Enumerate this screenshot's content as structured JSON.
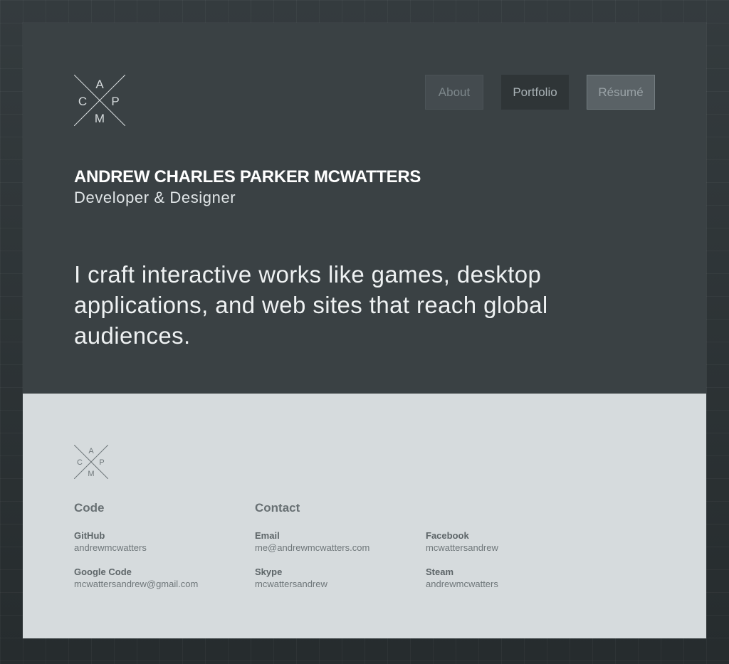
{
  "logo": {
    "letters": {
      "top": "A",
      "left": "C",
      "right": "P",
      "bottom": "M"
    }
  },
  "nav": {
    "about": "About",
    "portfolio": "Portfolio",
    "resume": "Résumé"
  },
  "hero": {
    "name": "ANDREW CHARLES PARKER MCWATTERS",
    "role": "Developer & Designer",
    "tagline": "I craft interactive works like games, desktop applications, and web sites that reach global audiences."
  },
  "footer": {
    "code": {
      "heading": "Code",
      "items": [
        {
          "label": "GitHub",
          "value": "andrewmcwatters"
        },
        {
          "label": "Google Code",
          "value": "mcwattersandrew@gmail.com"
        }
      ]
    },
    "contact": {
      "heading": "Contact",
      "items": [
        {
          "label": "Email",
          "value": "me@andrewmcwatters.com"
        },
        {
          "label": "Skype",
          "value": "mcwattersandrew"
        },
        {
          "label": "Facebook",
          "value": "mcwattersandrew"
        },
        {
          "label": "Steam",
          "value": "andrewmcwatters"
        }
      ]
    }
  },
  "colors": {
    "hero_background": "#3a4144",
    "footer_background": "#d6dbdd",
    "page_background": "#2b3133"
  }
}
